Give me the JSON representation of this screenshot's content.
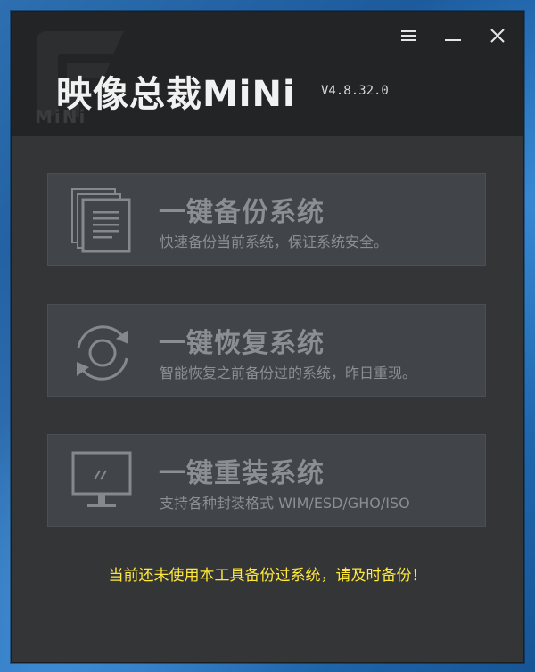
{
  "app": {
    "title": "映像总裁MiNi",
    "version": "V4.8.32.0",
    "bg_logo_text": "MiNi"
  },
  "window_controls": {
    "menu_icon": "hamburger-menu-icon",
    "minimize_icon": "minimize-icon",
    "close_icon": "close-icon"
  },
  "options": [
    {
      "icon": "document-stack-icon",
      "title": "一键备份系统",
      "description": "快速备份当前系统，保证系统安全。"
    },
    {
      "icon": "circular-arrows-icon",
      "title": "一键恢复系统",
      "description": "智能恢复之前备份过的系统，昨日重现。"
    },
    {
      "icon": "monitor-icon",
      "title": "一键重装系统",
      "description": "支持各种封装格式 WIM/ESD/GHO/ISO"
    }
  ],
  "status": {
    "warning": "当前还未使用本工具备份过系统，请及时备份！"
  },
  "colors": {
    "window_bg": "#333537",
    "header_bg": "#232425",
    "card_bg": "#414449",
    "card_text": "#8b8e92",
    "warning_text": "#ffe83a",
    "desktop_blue": "#1c5a9c"
  }
}
